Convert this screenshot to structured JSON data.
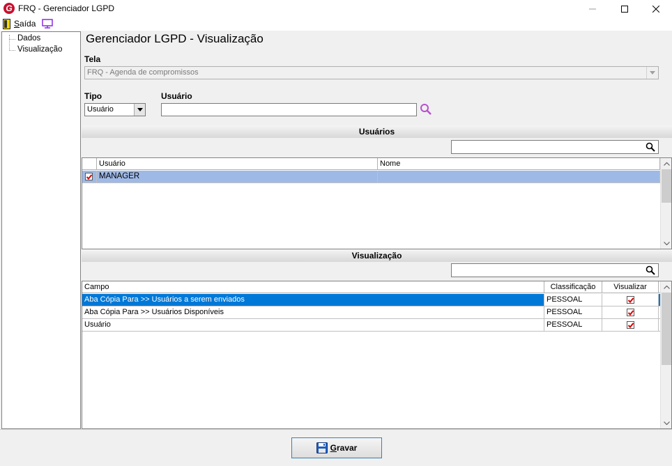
{
  "window": {
    "title": "FRQ - Gerenciador LGPD"
  },
  "menu": {
    "saida_label": "Saída"
  },
  "tree": {
    "items": [
      {
        "label": "Dados"
      },
      {
        "label": "Visualização"
      }
    ]
  },
  "page": {
    "title": "Gerenciador LGPD - Visualização"
  },
  "form": {
    "tela_label": "Tela",
    "tela_value": "FRQ - Agenda de compromissos",
    "tipo_label": "Tipo",
    "tipo_value": "Usuário",
    "usuario_label": "Usuário",
    "usuario_value": ""
  },
  "usuarios_section": {
    "title": "Usuários",
    "filter_value": "",
    "columns": [
      "Usuário",
      "Nome"
    ],
    "rows": [
      {
        "checked": true,
        "usuario": "MANAGER",
        "nome": ""
      }
    ]
  },
  "visualizacao_section": {
    "title": "Visualização",
    "filter_value": "",
    "columns": [
      "Campo",
      "Classificação",
      "Visualizar"
    ],
    "rows": [
      {
        "campo": "Aba Cópia Para >> Usuários a serem enviados",
        "classificacao": "PESSOAL",
        "visualizar": true
      },
      {
        "campo": "Aba Cópia Para >> Usuários Disponíveis",
        "classificacao": "PESSOAL",
        "visualizar": true
      },
      {
        "campo": "Usuário",
        "classificacao": "PESSOAL",
        "visualizar": true
      }
    ]
  },
  "actions": {
    "gravar_label_underlined": "G",
    "gravar_label_rest": "ravar"
  },
  "colors": {
    "selection_blue": "#0078d7",
    "selection_light": "#9fb9e6",
    "check_red": "#d40000",
    "app_icon_red": "#c8102e"
  },
  "icons": {
    "app": "app-logo-icon",
    "exit": "door-exit-icon",
    "monitor": "monitor-icon",
    "search": "magnifier-icon",
    "save": "floppy-disk-icon"
  }
}
